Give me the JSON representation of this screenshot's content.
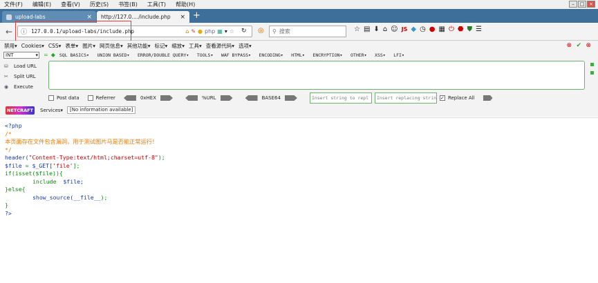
{
  "menubar": {
    "items": [
      "文件(F)",
      "编辑(E)",
      "查看(V)",
      "历史(S)",
      "书签(B)",
      "工具(T)",
      "帮助(H)"
    ]
  },
  "tabs": [
    {
      "label": "upload-labs",
      "close": "×"
    },
    {
      "label": "http://127.0.…/include.php",
      "close": "×"
    }
  ],
  "new_tab": "+",
  "url": {
    "value": "127.0.0.1/upload-labs/include.php"
  },
  "search": {
    "placeholder": "搜索"
  },
  "bookmarks": [
    "禁用▾",
    "Cookies▾",
    "CSS▾",
    "表单▾",
    "图片▾",
    "网页信息▾",
    "其他功能▾",
    "标记▾",
    "缩放▾",
    "工具▾",
    "查看源代码▾",
    "选项▾"
  ],
  "hackbar": {
    "select_value": "INT",
    "menu": [
      "SQL BASICS▾",
      "UNION BASED▾",
      "ERROR/DOUBLE QUERY▾",
      "TOOLS▾",
      "WAF BYPASS▾",
      "ENCODING▾",
      "HTML▾",
      "ENCRYPTION▾",
      "OTHER▾",
      "XSS▾",
      "LFI▾"
    ],
    "load_url": "Load URL",
    "split_url": "Split URL",
    "execute": "Execute",
    "post_data": "Post data",
    "referrer": "Referrer",
    "hex": "0xHEX",
    "url_enc": "%URL",
    "base64": "BASE64",
    "insert_placeholder": "Insert string to repl",
    "replacing_placeholder": "Insert replacing strin",
    "replace_all": "Replace All",
    "netcraft": "NETCRAFT",
    "services": "Services▾",
    "info": "[No information available]"
  },
  "code": {
    "open_tag": "<?php",
    "comment_open": "/*",
    "comment_text": "本页面存在文件包含漏洞，用于测试图片马是否能正常运行！",
    "comment_close": "*/",
    "l_header_fn": "header(",
    "l_header_str": "\"Content-Type:text/html;charset=utf-8\"",
    "l_header_end": ");",
    "l_file_var": "$file",
    "l_file_eq": " = ",
    "l_file_get": "$_GET[",
    "l_file_key": "'file'",
    "l_file_end": "];",
    "l_if": "if(isset($file)){",
    "l_include_kw": "include",
    "l_include_var": "$file;",
    "l_else": "}else{",
    "l_show_fn": "show_source(",
    "l_show_arg": "__file__",
    "l_show_end": ");",
    "l_close_brace": "}",
    "close_tag": "?>"
  }
}
